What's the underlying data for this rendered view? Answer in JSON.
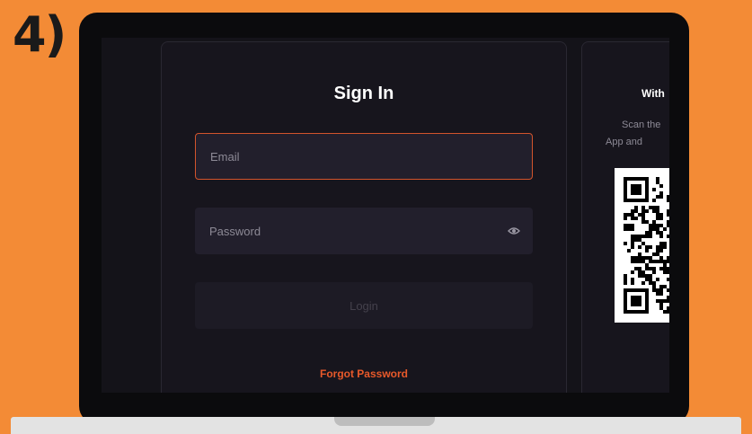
{
  "step_label": "4)",
  "signin": {
    "title": "Sign In",
    "email_placeholder": "Email",
    "password_placeholder": "Password",
    "login_label": "Login",
    "forgot_label": "Forgot Password"
  },
  "qr_panel": {
    "title": "With",
    "description_line1": "Scan the",
    "description_line2": "App and"
  },
  "icons": {
    "password_toggle": "eye-icon",
    "qr": "qr-code"
  },
  "colors": {
    "background": "#f38b36",
    "screen": "#141319",
    "card": "#17151d",
    "field": "#221f2c",
    "accent": "#e8592a",
    "focus_border": "#d2542c"
  }
}
